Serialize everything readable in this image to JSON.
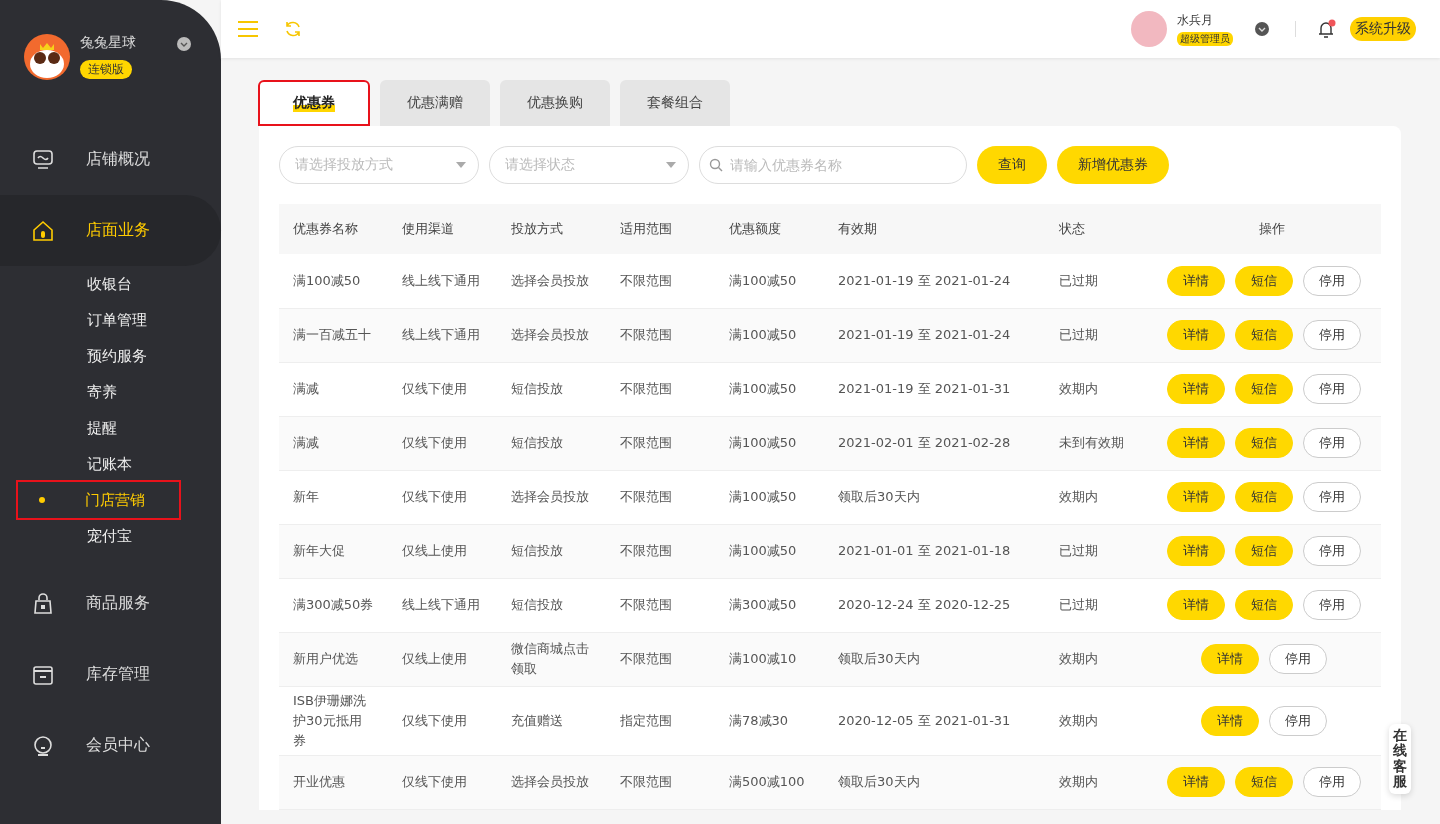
{
  "brand": {
    "name": "兔兔星球",
    "edition": "连锁版"
  },
  "nav": [
    {
      "label": "店铺概况",
      "selected": false
    },
    {
      "label": "店面业务",
      "selected": true,
      "children": [
        {
          "label": "收银台",
          "selected": false,
          "highlighted": false
        },
        {
          "label": "订单管理",
          "selected": false,
          "highlighted": false
        },
        {
          "label": "预约服务",
          "selected": false,
          "highlighted": false
        },
        {
          "label": "寄养",
          "selected": false,
          "highlighted": false
        },
        {
          "label": "提醒",
          "selected": false,
          "highlighted": false
        },
        {
          "label": "记账本",
          "selected": false,
          "highlighted": false
        },
        {
          "label": "门店营销",
          "selected": true,
          "highlighted": true
        },
        {
          "label": "宠付宝",
          "selected": false,
          "highlighted": false
        }
      ]
    },
    {
      "label": "商品服务",
      "selected": false
    },
    {
      "label": "库存管理",
      "selected": false
    },
    {
      "label": "会员中心",
      "selected": false
    }
  ],
  "user": {
    "name": "水兵月",
    "role": "超级管理员",
    "notification": true
  },
  "upgrade_button": "系统升级",
  "tabs": [
    {
      "label": "优惠券",
      "selected": true,
      "highlighted": true
    },
    {
      "label": "优惠满赠",
      "selected": false,
      "highlighted": false
    },
    {
      "label": "优惠换购",
      "selected": false,
      "highlighted": false
    },
    {
      "label": "套餐组合",
      "selected": false,
      "highlighted": false
    }
  ],
  "filters": {
    "method": {
      "placeholder": "请选择投放方式"
    },
    "status": {
      "placeholder": "请选择状态"
    },
    "search": {
      "placeholder": "请输入优惠券名称"
    },
    "query_button": "查询",
    "add_button": "新增优惠券"
  },
  "table": {
    "columns": [
      "优惠券名称",
      "使用渠道",
      "投放方式",
      "适用范围",
      "优惠额度",
      "有效期",
      "状态",
      "操作"
    ],
    "rows": [
      {
        "cells": [
          "满100减50",
          "线上线下通用",
          "选择会员投放",
          "不限范围",
          "满100减50",
          "2021-01-19 至 2021-01-24",
          "已过期"
        ],
        "actions": [
          {
            "label": "详情",
            "kind": "primary"
          },
          {
            "label": "短信",
            "kind": "primary"
          },
          {
            "label": "停用",
            "kind": "outline"
          }
        ]
      },
      {
        "cells": [
          "满一百减五十",
          "线上线下通用",
          "选择会员投放",
          "不限范围",
          "满100减50",
          "2021-01-19 至 2021-01-24",
          "已过期"
        ],
        "actions": [
          {
            "label": "详情",
            "kind": "primary"
          },
          {
            "label": "短信",
            "kind": "primary"
          },
          {
            "label": "停用",
            "kind": "outline"
          }
        ]
      },
      {
        "cells": [
          "满减",
          "仅线下使用",
          "短信投放",
          "不限范围",
          "满100减50",
          "2021-01-19 至 2021-01-31",
          "效期内"
        ],
        "actions": [
          {
            "label": "详情",
            "kind": "primary"
          },
          {
            "label": "短信",
            "kind": "primary"
          },
          {
            "label": "停用",
            "kind": "outline"
          }
        ]
      },
      {
        "cells": [
          "满减",
          "仅线下使用",
          "短信投放",
          "不限范围",
          "满100减50",
          "2021-02-01 至 2021-02-28",
          "未到有效期"
        ],
        "actions": [
          {
            "label": "详情",
            "kind": "primary"
          },
          {
            "label": "短信",
            "kind": "primary"
          },
          {
            "label": "停用",
            "kind": "outline"
          }
        ]
      },
      {
        "cells": [
          "新年",
          "仅线下使用",
          "选择会员投放",
          "不限范围",
          "满100减50",
          "领取后30天内",
          "效期内"
        ],
        "actions": [
          {
            "label": "详情",
            "kind": "primary"
          },
          {
            "label": "短信",
            "kind": "primary"
          },
          {
            "label": "停用",
            "kind": "outline"
          }
        ]
      },
      {
        "cells": [
          "新年大促",
          "仅线上使用",
          "短信投放",
          "不限范围",
          "满100减50",
          "2021-01-01 至 2021-01-18",
          "已过期"
        ],
        "actions": [
          {
            "label": "详情",
            "kind": "primary"
          },
          {
            "label": "短信",
            "kind": "primary"
          },
          {
            "label": "停用",
            "kind": "outline"
          }
        ]
      },
      {
        "cells": [
          "满300减50券",
          "线上线下通用",
          "短信投放",
          "不限范围",
          "满300减50",
          "2020-12-24 至 2020-12-25",
          "已过期"
        ],
        "actions": [
          {
            "label": "详情",
            "kind": "primary"
          },
          {
            "label": "短信",
            "kind": "primary"
          },
          {
            "label": "停用",
            "kind": "outline"
          }
        ]
      },
      {
        "cells": [
          "新用户优选",
          "仅线上使用",
          "微信商城点击领取",
          "不限范围",
          "满100减10",
          "领取后30天内",
          "效期内"
        ],
        "actions": [
          {
            "label": "详情",
            "kind": "primary"
          },
          {
            "label": "停用",
            "kind": "outline"
          }
        ]
      },
      {
        "cells": [
          "ISB伊珊娜洗护30元抵用券",
          "仅线下使用",
          "充值赠送",
          "指定范围",
          "满78减30",
          "2020-12-05 至 2021-01-31",
          "效期内"
        ],
        "actions": [
          {
            "label": "详情",
            "kind": "primary"
          },
          {
            "label": "停用",
            "kind": "outline"
          }
        ]
      },
      {
        "cells": [
          "开业优惠",
          "仅线下使用",
          "选择会员投放",
          "不限范围",
          "满500减100",
          "领取后30天内",
          "效期内"
        ],
        "actions": [
          {
            "label": "详情",
            "kind": "primary"
          },
          {
            "label": "短信",
            "kind": "primary"
          },
          {
            "label": "停用",
            "kind": "outline"
          }
        ]
      }
    ]
  },
  "support_button": "在线客服"
}
